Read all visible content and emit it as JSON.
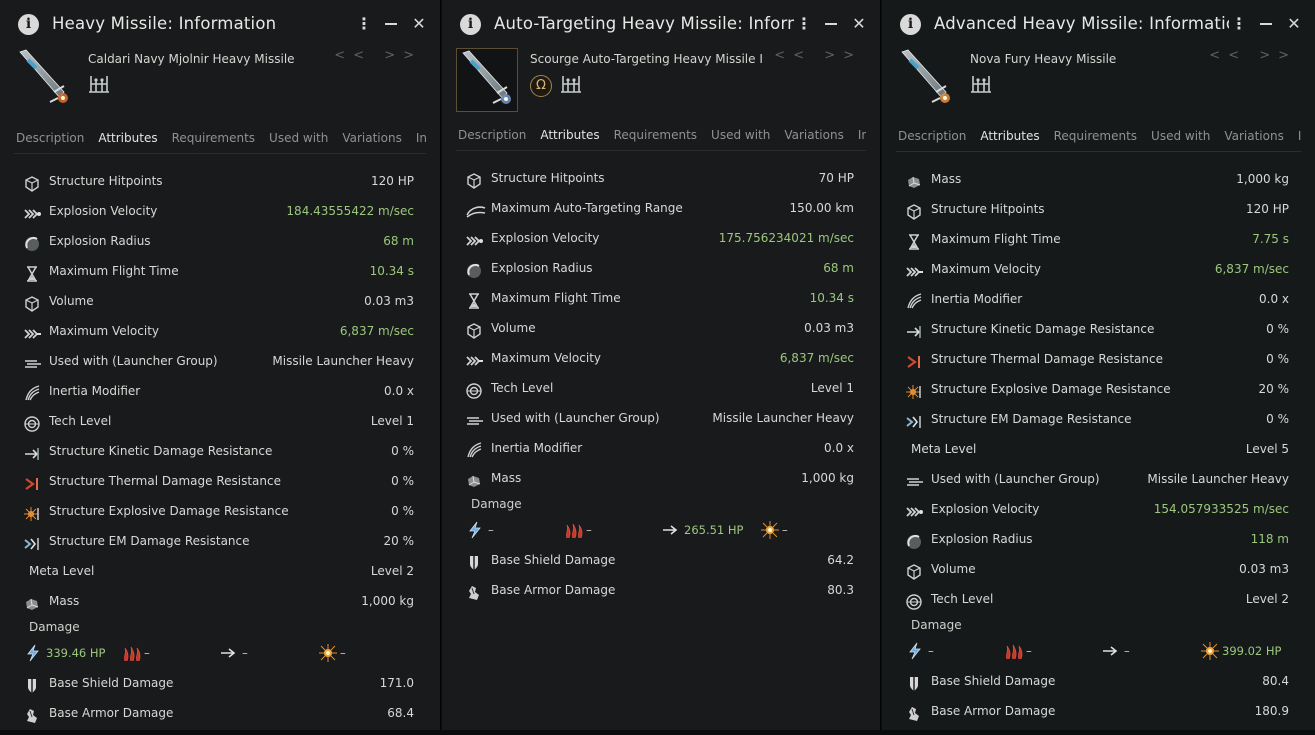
{
  "panels": [
    {
      "title": "Heavy Missile: Information",
      "item_name": "Caldari Navy Mjolnir Heavy Missile",
      "has_omega_badge": false,
      "accent": "#d86a2a",
      "nav": "<< >>",
      "tabs": [
        "Description",
        "Attributes",
        "Requirements",
        "Used with",
        "Variations",
        "Industry"
      ],
      "active_tab": "Attributes",
      "attributes": [
        {
          "icon": "structure-icon",
          "label": "Structure Hitpoints",
          "value": "120 HP",
          "green": false
        },
        {
          "icon": "explosion-velocity-icon",
          "label": "Explosion Velocity",
          "value": "184.43555422 m/sec",
          "green": true
        },
        {
          "icon": "explosion-radius-icon",
          "label": "Explosion Radius",
          "value": "68 m",
          "green": true
        },
        {
          "icon": "hourglass-icon",
          "label": "Maximum Flight Time",
          "value": "10.34 s",
          "green": true
        },
        {
          "icon": "volume-icon",
          "label": "Volume",
          "value": "0.03 m3",
          "green": false
        },
        {
          "icon": "velocity-icon",
          "label": "Maximum Velocity",
          "value": "6,837 m/sec",
          "green": true
        },
        {
          "icon": "launcher-group-icon",
          "label": "Used with (Launcher Group)",
          "value": "Missile Launcher Heavy",
          "green": false
        },
        {
          "icon": "inertia-icon",
          "label": "Inertia Modifier",
          "value": "0.0 x",
          "green": false
        },
        {
          "icon": "tech-level-icon",
          "label": "Tech Level",
          "value": "Level 1",
          "green": false
        },
        {
          "icon": "kinetic-resist-icon",
          "label": "Structure Kinetic Damage Resistance",
          "value": "0 %",
          "green": false
        },
        {
          "icon": "thermal-resist-icon",
          "label": "Structure Thermal Damage Resistance",
          "value": "0 %",
          "green": false
        },
        {
          "icon": "explosive-resist-icon",
          "label": "Structure Explosive Damage Resistance",
          "value": "0 %",
          "green": false
        },
        {
          "icon": "em-resist-icon",
          "label": "Structure EM Damage Resistance",
          "value": "20 %",
          "green": false
        },
        {
          "icon": "",
          "label": "Meta Level",
          "value": "Level 2",
          "green": false
        },
        {
          "icon": "mass-icon",
          "label": "Mass",
          "value": "1,000 kg",
          "green": false
        }
      ],
      "damage_label": "Damage",
      "damage": {
        "em": "339.46 HP",
        "thermal": "–",
        "kinetic": "–",
        "explosive": "–"
      },
      "damage_green": "em",
      "tail": [
        {
          "icon": "shield-damage-icon",
          "label": "Base Shield Damage",
          "value": "171.0"
        },
        {
          "icon": "armor-damage-icon",
          "label": "Base Armor Damage",
          "value": "68.4"
        }
      ]
    },
    {
      "title": "Auto-Targeting Heavy Missile: Informa",
      "item_name": "Scourge Auto-Targeting Heavy Missile I",
      "has_omega_badge": true,
      "accent": "#6f8fc0",
      "nav": "<< >>",
      "tabs": [
        "Description",
        "Attributes",
        "Requirements",
        "Used with",
        "Variations",
        "Industry"
      ],
      "active_tab": "Attributes",
      "attributes": [
        {
          "icon": "structure-icon",
          "label": "Structure Hitpoints",
          "value": "70 HP",
          "green": false
        },
        {
          "icon": "auto-target-range-icon",
          "label": "Maximum Auto-Targeting Range",
          "value": "150.00 km",
          "green": false
        },
        {
          "icon": "explosion-velocity-icon",
          "label": "Explosion Velocity",
          "value": "175.756234021 m/sec",
          "green": true
        },
        {
          "icon": "explosion-radius-icon",
          "label": "Explosion Radius",
          "value": "68 m",
          "green": true
        },
        {
          "icon": "hourglass-icon",
          "label": "Maximum Flight Time",
          "value": "10.34 s",
          "green": true
        },
        {
          "icon": "volume-icon",
          "label": "Volume",
          "value": "0.03 m3",
          "green": false
        },
        {
          "icon": "velocity-icon",
          "label": "Maximum Velocity",
          "value": "6,837 m/sec",
          "green": true
        },
        {
          "icon": "tech-level-icon",
          "label": "Tech Level",
          "value": "Level 1",
          "green": false
        },
        {
          "icon": "launcher-group-icon",
          "label": "Used with (Launcher Group)",
          "value": "Missile Launcher Heavy",
          "green": false
        },
        {
          "icon": "inertia-icon",
          "label": "Inertia Modifier",
          "value": "0.0 x",
          "green": false
        },
        {
          "icon": "mass-icon",
          "label": "Mass",
          "value": "1,000 kg",
          "green": false
        }
      ],
      "damage_label": "Damage",
      "damage": {
        "em": "–",
        "thermal": "–",
        "kinetic": "265.51 HP",
        "explosive": "–"
      },
      "damage_green": "kinetic",
      "tail": [
        {
          "icon": "shield-damage-icon",
          "label": "Base Shield Damage",
          "value": "64.2"
        },
        {
          "icon": "armor-damage-icon",
          "label": "Base Armor Damage",
          "value": "80.3"
        }
      ]
    },
    {
      "title": "Advanced Heavy Missile: Information",
      "item_name": "Nova Fury Heavy Missile",
      "has_omega_badge": false,
      "accent": "#d88a3a",
      "nav": "<< >>",
      "tabs": [
        "Description",
        "Attributes",
        "Requirements",
        "Used with",
        "Variations",
        "Industry"
      ],
      "active_tab": "Attributes",
      "attributes": [
        {
          "icon": "mass-icon",
          "label": "Mass",
          "value": "1,000 kg",
          "green": false
        },
        {
          "icon": "structure-icon",
          "label": "Structure Hitpoints",
          "value": "120 HP",
          "green": false
        },
        {
          "icon": "hourglass-icon",
          "label": "Maximum Flight Time",
          "value": "7.75 s",
          "green": true
        },
        {
          "icon": "velocity-icon",
          "label": "Maximum Velocity",
          "value": "6,837 m/sec",
          "green": true
        },
        {
          "icon": "inertia-icon",
          "label": "Inertia Modifier",
          "value": "0.0 x",
          "green": false
        },
        {
          "icon": "kinetic-resist-icon",
          "label": "Structure Kinetic Damage Resistance",
          "value": "0 %",
          "green": false
        },
        {
          "icon": "thermal-resist-icon",
          "label": "Structure Thermal Damage Resistance",
          "value": "0 %",
          "green": false
        },
        {
          "icon": "explosive-resist-icon",
          "label": "Structure Explosive Damage Resistance",
          "value": "20 %",
          "green": false
        },
        {
          "icon": "em-resist-icon",
          "label": "Structure EM Damage Resistance",
          "value": "0 %",
          "green": false
        },
        {
          "icon": "",
          "label": "Meta Level",
          "value": "Level 5",
          "green": false
        },
        {
          "icon": "launcher-group-icon",
          "label": "Used with (Launcher Group)",
          "value": "Missile Launcher Heavy",
          "green": false
        },
        {
          "icon": "explosion-velocity-icon",
          "label": "Explosion Velocity",
          "value": "154.057933525 m/sec",
          "green": true
        },
        {
          "icon": "explosion-radius-icon",
          "label": "Explosion Radius",
          "value": "118 m",
          "green": true
        },
        {
          "icon": "volume-icon",
          "label": "Volume",
          "value": "0.03 m3",
          "green": false
        },
        {
          "icon": "tech-level-icon",
          "label": "Tech Level",
          "value": "Level 2",
          "green": false
        }
      ],
      "damage_label": "Damage",
      "damage": {
        "em": "–",
        "thermal": "–",
        "kinetic": "–",
        "explosive": "399.02 HP"
      },
      "damage_green": "explosive",
      "tail": [
        {
          "icon": "shield-damage-icon",
          "label": "Base Shield Damage",
          "value": "80.4"
        },
        {
          "icon": "armor-damage-icon",
          "label": "Base Armor Damage",
          "value": "180.9"
        }
      ]
    }
  ]
}
